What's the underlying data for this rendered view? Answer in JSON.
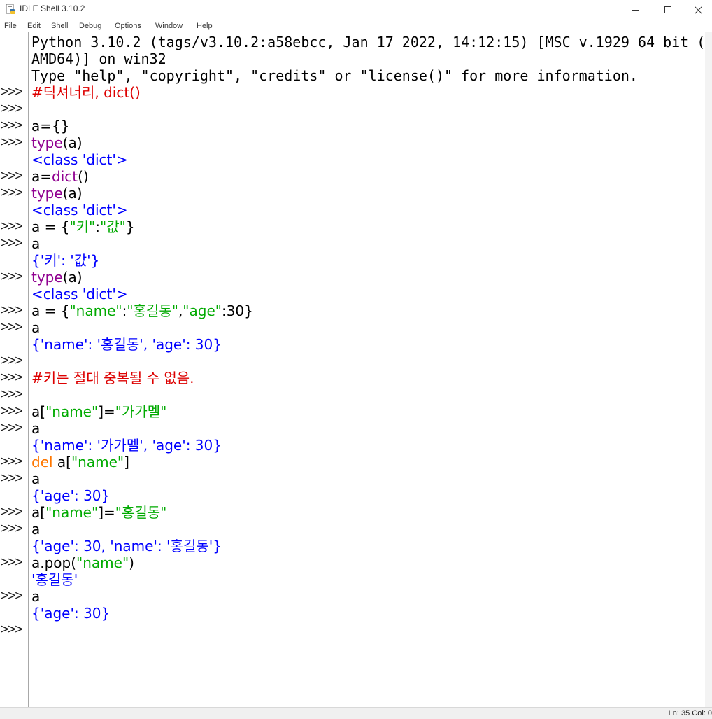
{
  "window": {
    "title": "IDLE Shell 3.10.2",
    "controls": {
      "minimize": "─",
      "maximize": "☐",
      "close": "✕"
    }
  },
  "menu": [
    "File",
    "Edit",
    "Shell",
    "Debug",
    "Options",
    "Window",
    "Help"
  ],
  "prompt": ">>>",
  "lines": [
    {
      "prompt": false,
      "segs": [
        {
          "t": "Python 3.10.2 (tags/v3.10.2:a58ebcc, Jan 17 2022, 14:12:15) [MSC v.1929 64 bit (",
          "c": "plain"
        }
      ]
    },
    {
      "prompt": false,
      "segs": [
        {
          "t": "AMD64)] on win32",
          "c": "plain"
        }
      ]
    },
    {
      "prompt": false,
      "segs": [
        {
          "t": "Type \"help\", \"copyright\", \"credits\" or \"license()\" for more information.",
          "c": "plain"
        }
      ]
    },
    {
      "prompt": true,
      "segs": [
        {
          "t": "#딕셔너리, dict()",
          "c": "comment"
        }
      ]
    },
    {
      "prompt": true,
      "segs": []
    },
    {
      "prompt": true,
      "segs": [
        {
          "t": "a={}",
          "c": "plain"
        }
      ]
    },
    {
      "prompt": true,
      "segs": [
        {
          "t": "type",
          "c": "builtin"
        },
        {
          "t": "(a)",
          "c": "plain"
        }
      ]
    },
    {
      "prompt": false,
      "segs": [
        {
          "t": "<class 'dict'>",
          "c": "stdout"
        }
      ]
    },
    {
      "prompt": true,
      "segs": [
        {
          "t": "a=",
          "c": "plain"
        },
        {
          "t": "dict",
          "c": "builtin"
        },
        {
          "t": "()",
          "c": "plain"
        }
      ]
    },
    {
      "prompt": true,
      "segs": [
        {
          "t": "type",
          "c": "builtin"
        },
        {
          "t": "(a)",
          "c": "plain"
        }
      ]
    },
    {
      "prompt": false,
      "segs": [
        {
          "t": "<class 'dict'>",
          "c": "stdout"
        }
      ]
    },
    {
      "prompt": true,
      "segs": [
        {
          "t": "a = {",
          "c": "plain"
        },
        {
          "t": "\"키\"",
          "c": "string"
        },
        {
          "t": ":",
          "c": "plain"
        },
        {
          "t": "\"값\"",
          "c": "string"
        },
        {
          "t": "}",
          "c": "plain"
        }
      ]
    },
    {
      "prompt": true,
      "segs": [
        {
          "t": "a",
          "c": "plain"
        }
      ]
    },
    {
      "prompt": false,
      "segs": [
        {
          "t": "{'키': '값'}",
          "c": "stdout"
        }
      ]
    },
    {
      "prompt": true,
      "segs": [
        {
          "t": "type",
          "c": "builtin"
        },
        {
          "t": "(a)",
          "c": "plain"
        }
      ]
    },
    {
      "prompt": false,
      "segs": [
        {
          "t": "<class 'dict'>",
          "c": "stdout"
        }
      ]
    },
    {
      "prompt": true,
      "segs": [
        {
          "t": "a = {",
          "c": "plain"
        },
        {
          "t": "\"name\"",
          "c": "string"
        },
        {
          "t": ":",
          "c": "plain"
        },
        {
          "t": "\"홍길동\"",
          "c": "string"
        },
        {
          "t": ",",
          "c": "plain"
        },
        {
          "t": "\"age\"",
          "c": "string"
        },
        {
          "t": ":30}",
          "c": "plain"
        }
      ]
    },
    {
      "prompt": true,
      "segs": [
        {
          "t": "a",
          "c": "plain"
        }
      ]
    },
    {
      "prompt": false,
      "segs": [
        {
          "t": "{'name': '홍길동', 'age': 30}",
          "c": "stdout"
        }
      ]
    },
    {
      "prompt": true,
      "segs": []
    },
    {
      "prompt": true,
      "segs": [
        {
          "t": "#키는 절대 중복될 수 없음.",
          "c": "comment"
        }
      ]
    },
    {
      "prompt": true,
      "segs": []
    },
    {
      "prompt": true,
      "segs": [
        {
          "t": "a[",
          "c": "plain"
        },
        {
          "t": "\"name\"",
          "c": "string"
        },
        {
          "t": "]=",
          "c": "plain"
        },
        {
          "t": "\"가가멜\"",
          "c": "string"
        }
      ]
    },
    {
      "prompt": true,
      "segs": [
        {
          "t": "a",
          "c": "plain"
        }
      ]
    },
    {
      "prompt": false,
      "segs": [
        {
          "t": "{'name': '가가멜', 'age': 30}",
          "c": "stdout"
        }
      ]
    },
    {
      "prompt": true,
      "segs": [
        {
          "t": "del",
          "c": "keyword"
        },
        {
          "t": " a[",
          "c": "plain"
        },
        {
          "t": "\"name\"",
          "c": "string"
        },
        {
          "t": "]",
          "c": "plain"
        }
      ]
    },
    {
      "prompt": true,
      "segs": [
        {
          "t": "a",
          "c": "plain"
        }
      ]
    },
    {
      "prompt": false,
      "segs": [
        {
          "t": "{'age': 30}",
          "c": "stdout"
        }
      ]
    },
    {
      "prompt": true,
      "segs": [
        {
          "t": "a[",
          "c": "plain"
        },
        {
          "t": "\"name\"",
          "c": "string"
        },
        {
          "t": "]=",
          "c": "plain"
        },
        {
          "t": "\"홍길동\"",
          "c": "string"
        }
      ]
    },
    {
      "prompt": true,
      "segs": [
        {
          "t": "a",
          "c": "plain"
        }
      ]
    },
    {
      "prompt": false,
      "segs": [
        {
          "t": "{'age': 30, 'name': '홍길동'}",
          "c": "stdout"
        }
      ]
    },
    {
      "prompt": true,
      "segs": [
        {
          "t": "a.pop(",
          "c": "plain"
        },
        {
          "t": "\"name\"",
          "c": "string"
        },
        {
          "t": ")",
          "c": "plain"
        }
      ]
    },
    {
      "prompt": false,
      "segs": [
        {
          "t": "'홍길동'",
          "c": "stdout"
        }
      ]
    },
    {
      "prompt": true,
      "segs": [
        {
          "t": "a",
          "c": "plain"
        }
      ]
    },
    {
      "prompt": false,
      "segs": [
        {
          "t": "{'age': 30}",
          "c": "stdout"
        }
      ]
    },
    {
      "prompt": true,
      "segs": []
    }
  ],
  "status": {
    "text": "Ln: 35  Col: 0"
  },
  "colors": {
    "comment": "#dd0000",
    "builtin": "#900090",
    "string": "#00aa00",
    "keyword": "#ff7700",
    "stdout": "#0000ff",
    "plain": "#000000"
  }
}
